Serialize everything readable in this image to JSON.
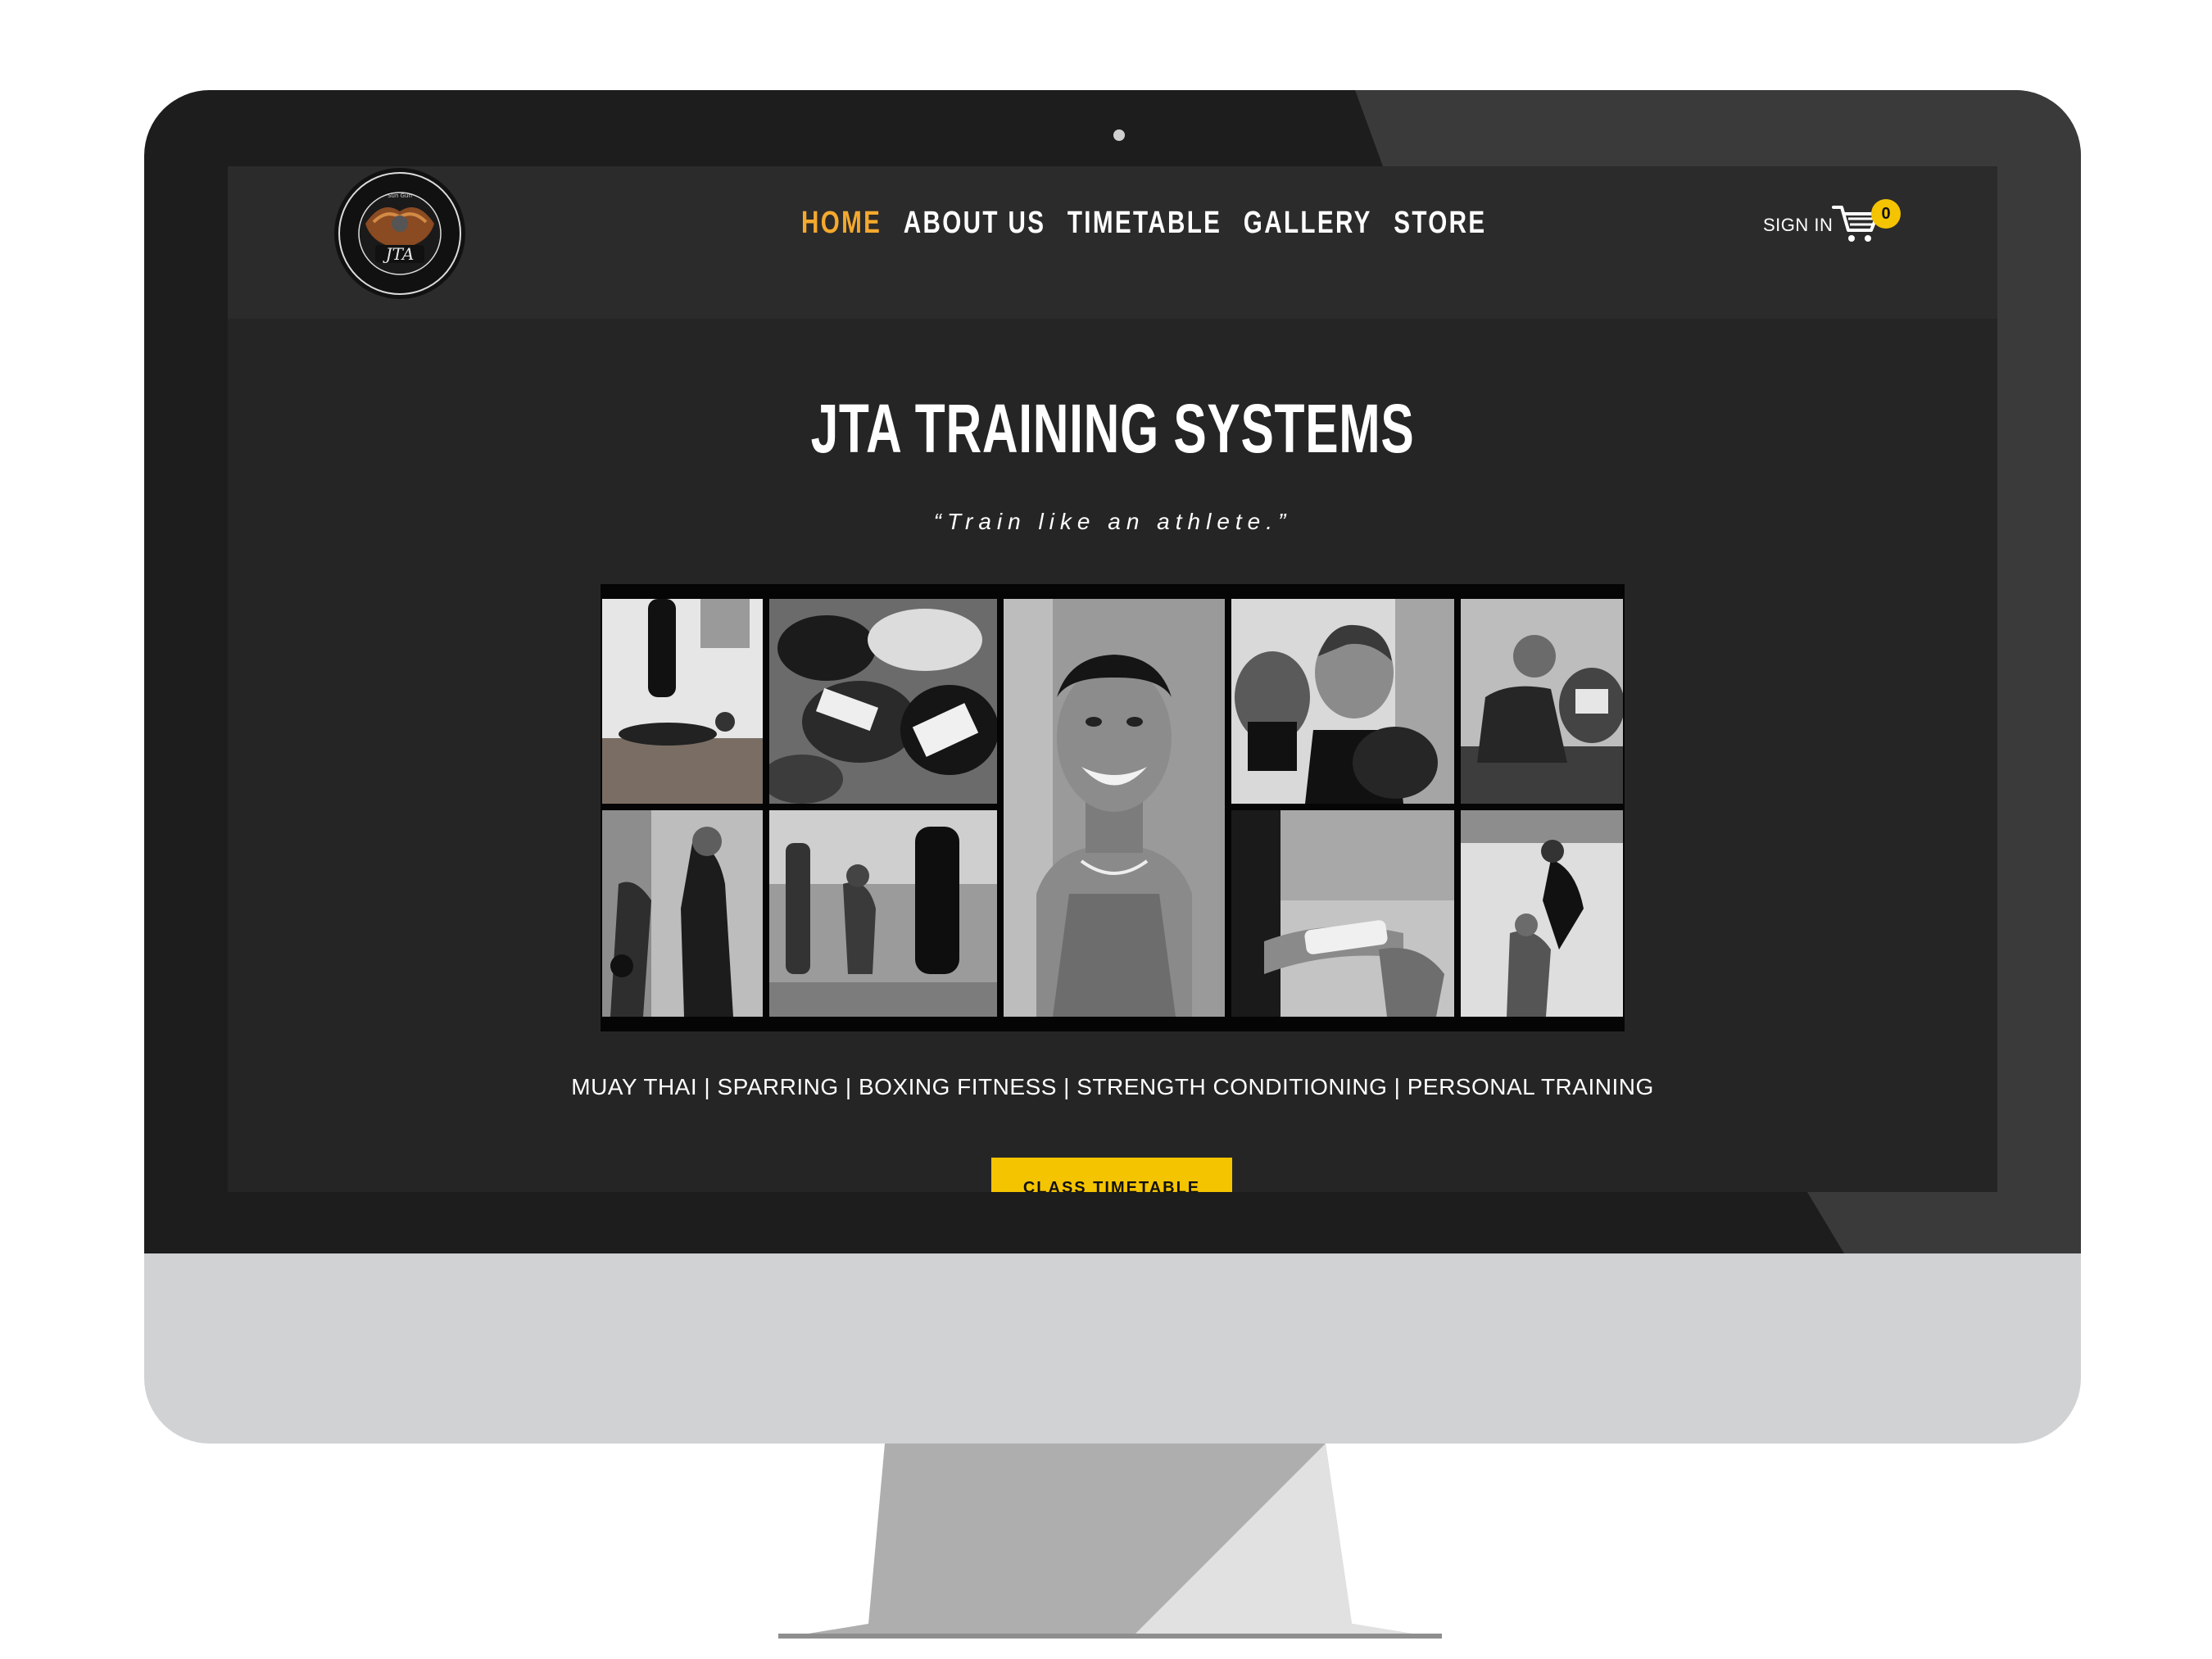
{
  "header": {
    "logo_alt": "JTA",
    "nav": [
      {
        "label": "HOME",
        "active": true
      },
      {
        "label": "ABOUT US",
        "active": false
      },
      {
        "label": "TIMETABLE",
        "active": false
      },
      {
        "label": "GALLERY",
        "active": false
      },
      {
        "label": "STORE",
        "active": false
      }
    ],
    "sign_in": "SIGN IN",
    "cart_count": "0"
  },
  "hero": {
    "title": "JTA TRAINING SYSTEMS",
    "tagline": "“Train like an athlete.”",
    "services": "MUAY THAI | SPARRING | BOXING FITNESS | STRENGTH CONDITIONING | PERSONAL TRAINING",
    "cta_label": "CLASS TIMETABLE"
  },
  "gallery": {
    "photos": [
      "heavy-bag-floor-photo",
      "boxing-gloves-pile-photo",
      "smiling-trainer-portrait-photo",
      "boy-with-gloves-photo",
      "man-punching-photo",
      "padwork-training-photo",
      "bag-work-gym-photo",
      "hand-wrapping-photo",
      "lifting-partner-photo"
    ]
  },
  "colors": {
    "accent_nav": "#f5a92d",
    "cta_yellow": "#f5c400",
    "page_bg": "#252525",
    "header_bg": "#2b2b2b"
  }
}
